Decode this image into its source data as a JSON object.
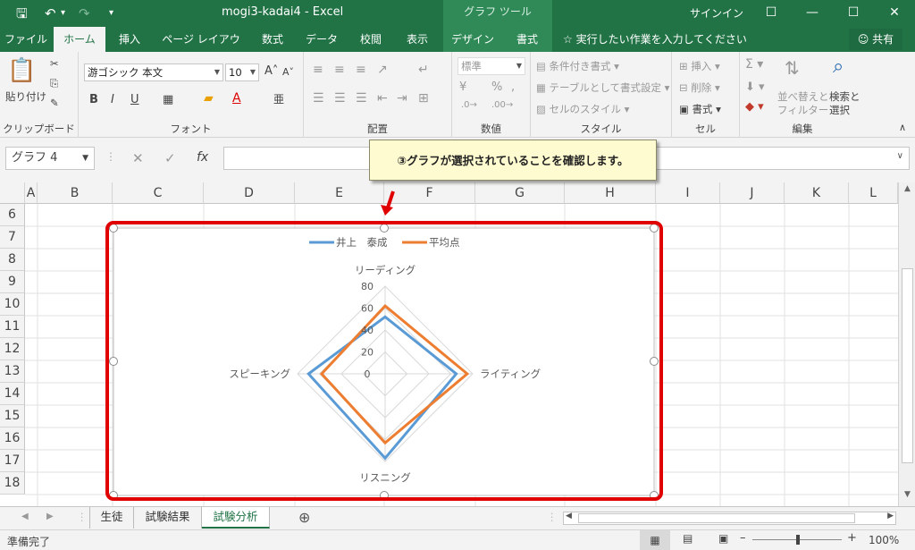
{
  "titlebar": {
    "title": "mogi3-kadai4  -  Excel",
    "tool_tab": "グラフ ツール",
    "signin": "サインイン"
  },
  "tabs": [
    "ファイル",
    "ホーム",
    "挿入",
    "ページ レイアウト",
    "数式",
    "データ",
    "校閲",
    "表示",
    "デザイン",
    "書式"
  ],
  "tell_me": "実行したい作業を入力してください",
  "share": "共有",
  "ribbon": {
    "clipboard": {
      "paste": "貼り付け",
      "label": "クリップボード"
    },
    "font": {
      "name": "游ゴシック 本文",
      "size": "10",
      "bold": "B",
      "italic": "I",
      "underline": "U",
      "label": "フォント"
    },
    "alignment": {
      "label": "配置"
    },
    "number": {
      "format": "標準",
      "label": "数値"
    },
    "styles": {
      "conditional": "条件付き書式",
      "table": "テーブルとして書式設定",
      "cell": "セルのスタイル",
      "label": "スタイル"
    },
    "cells": {
      "insert": "挿入",
      "delete": "削除",
      "format": "書式",
      "label": "セル"
    },
    "editing": {
      "sort": "並べ替えと",
      "filter": "フィルター",
      "find": "検索と",
      "select": "選択",
      "label": "編集"
    }
  },
  "namebox": "グラフ 4",
  "formula_fx": "fx",
  "callout": "③グラフが選択されていることを確認します。",
  "columns": [
    "A",
    "B",
    "C",
    "D",
    "E",
    "F",
    "G",
    "H",
    "I",
    "J",
    "K",
    "L"
  ],
  "rows": [
    "6",
    "7",
    "8",
    "9",
    "10",
    "11",
    "12",
    "13",
    "14",
    "15",
    "16",
    "17",
    "18"
  ],
  "chart_data": {
    "type": "radar",
    "categories": [
      "リーディング",
      "ライティング",
      "リスニング",
      "スピーキング"
    ],
    "series": [
      {
        "name": "井上　泰成",
        "color": "#5b9bd5",
        "values": [
          52,
          65,
          77,
          70
        ]
      },
      {
        "name": "平均点",
        "color": "#ed7d31",
        "values": [
          62,
          75,
          63,
          58
        ]
      }
    ],
    "ticks": [
      0,
      20,
      40,
      60,
      80
    ],
    "rmax": 80
  },
  "sheet_tabs": [
    "生徒",
    "試験結果",
    "試験分析"
  ],
  "status": {
    "ready": "準備完了",
    "zoom": "100%"
  },
  "colors": {
    "excel_green": "#217346",
    "highlight_red": "#e00000"
  }
}
